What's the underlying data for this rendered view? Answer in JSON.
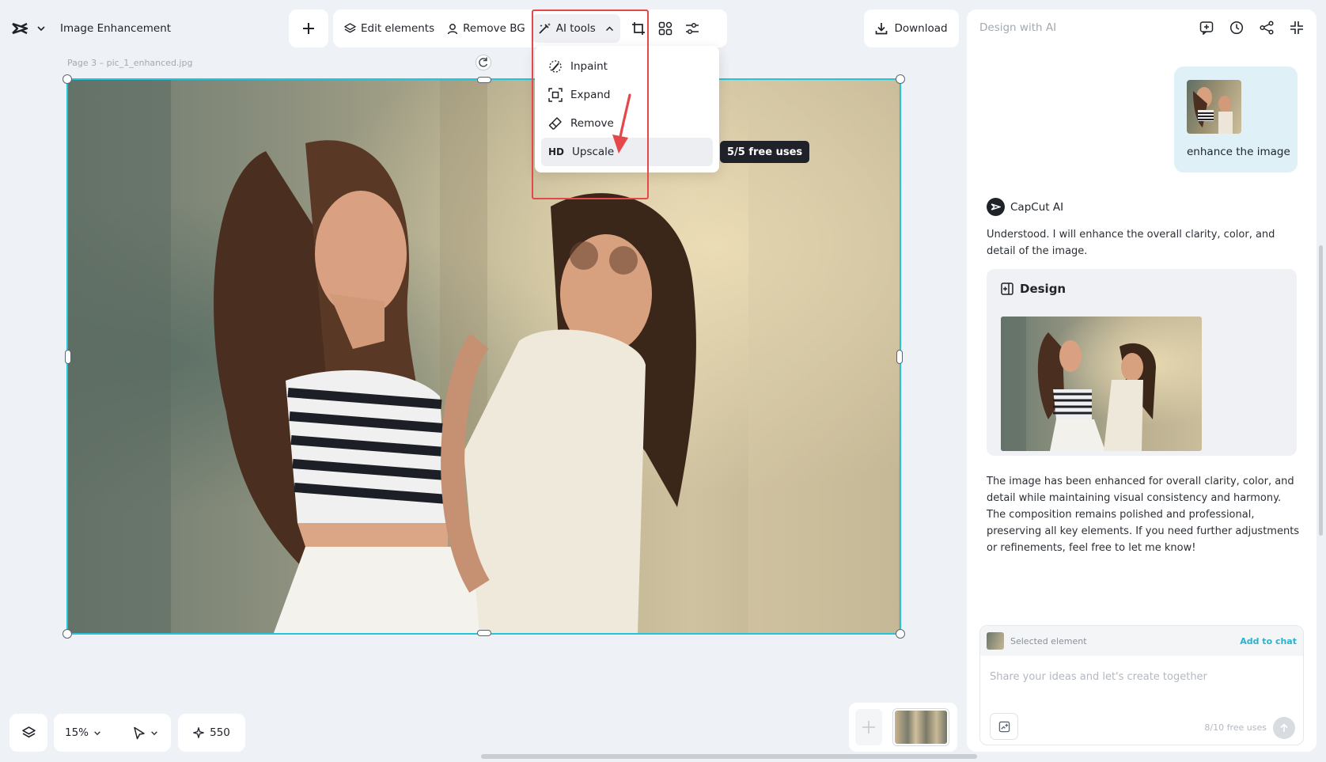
{
  "header": {
    "project_title": "Image Enhancement",
    "add_label": "+",
    "edit_elements_label": "Edit elements",
    "remove_bg_label": "Remove BG",
    "ai_tools_label": "AI tools",
    "download_label": "Download"
  },
  "ai_tools_menu": {
    "items": [
      {
        "label": "Inpaint",
        "icon": "brush-icon"
      },
      {
        "label": "Expand",
        "icon": "expand-icon"
      },
      {
        "label": "Remove",
        "icon": "eraser-icon"
      },
      {
        "label": "Upscale",
        "icon": "HD"
      }
    ],
    "highlighted": "Upscale",
    "tooltip": "5/5 free uses"
  },
  "canvas": {
    "page_label": "Page 3 –  pic_1_enhanced.jpg",
    "selection_color": "#22c5dc"
  },
  "annotation": {
    "color": "#e5474a"
  },
  "right_panel": {
    "title": "Design with AI",
    "user_message": "enhance the image",
    "assistant_name": "CapCut AI",
    "assistant_reply_1": "Understood. I will enhance the overall clarity, color, and detail of the image.",
    "design_card_title": "Design",
    "assistant_reply_2": "The image has been enhanced for overall clarity, color, and detail while maintaining visual consistency and harmony. The composition remains polished and professional, preserving all key elements. If you need further adjustments or refinements, feel free to let me know!",
    "selected_element_label": "Selected element",
    "add_to_chat_label": "Add to chat",
    "chat_placeholder": "Share your ideas and let's create together",
    "free_uses": "8/10 free uses",
    "accent_color": "#2ab2cf"
  },
  "bottom_bar": {
    "zoom": "15%",
    "credits": "550"
  }
}
